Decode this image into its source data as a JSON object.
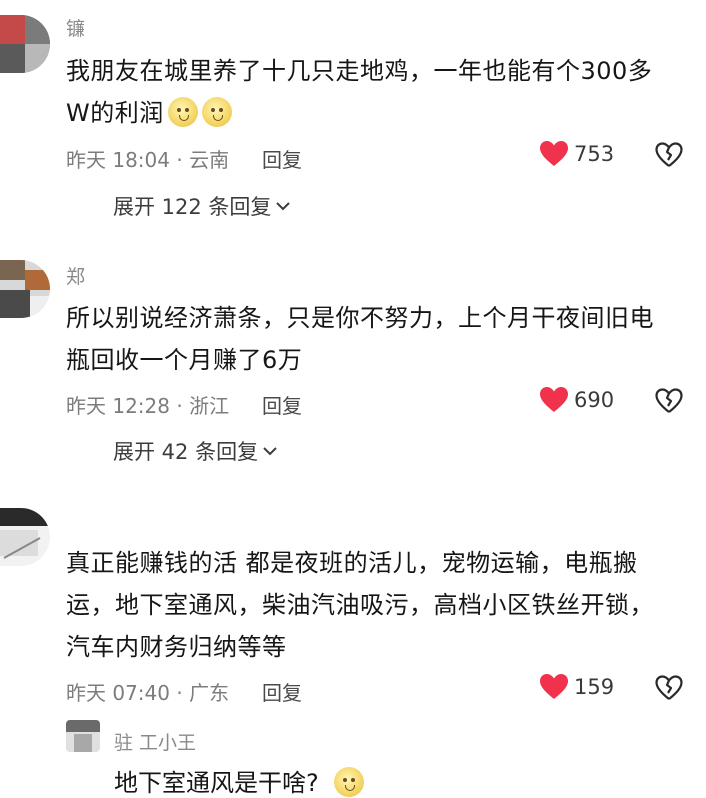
{
  "comments": [
    {
      "username": "镰",
      "lines": [
        "我朋友在城里养了十几只走地鸡，一年也能有个300多",
        "W的利润"
      ],
      "emojis": [
        "sweat-smile-emoji",
        "sweat-smile-emoji"
      ],
      "time": "昨天 18:04 · 云南",
      "reply_label": "回复",
      "likes": "753",
      "expand_label": "展开 122 条回复"
    },
    {
      "username": "郑",
      "lines": [
        "所以别说经济萧条，只是你不努力，上个月干夜间旧电",
        "瓶回收一个月赚了6万"
      ],
      "time": "昨天 12:28 · 浙江",
      "reply_label": "回复",
      "likes": "690",
      "expand_label": "展开 42 条回复"
    },
    {
      "username": "",
      "lines": [
        "真正能赚钱的活 都是夜班的活儿，宠物运输，电瓶搬",
        "运，地下室通风，柴油汽油吸污，高档小区铁丝开锁，",
        "汽车内财务归纳等等"
      ],
      "time": "昨天 07:40 · 广东",
      "reply_label": "回复",
      "likes": "159"
    }
  ],
  "sub_reply": {
    "username": "驻 工小王",
    "text": "地下室通风是干啥?",
    "emoji": "thinking-emoji"
  },
  "colors": {
    "heart": "#f0324d",
    "text": "#161616",
    "meta": "#7c7c7c"
  },
  "icons": {
    "like": "heart-icon",
    "dislike": "broken-heart-icon",
    "expand": "chevron-down-icon"
  }
}
